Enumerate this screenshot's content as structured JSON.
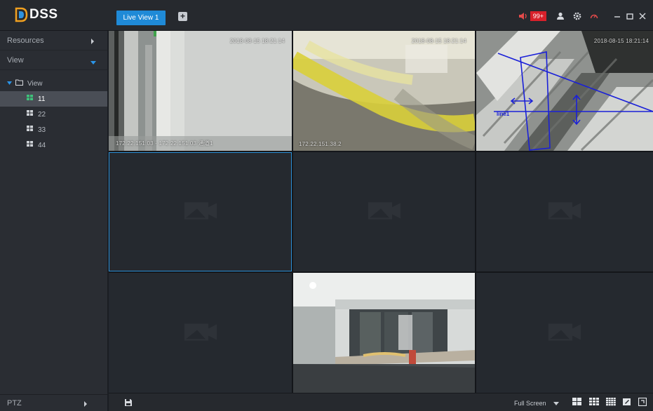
{
  "app": {
    "name": "DSS"
  },
  "tabs": [
    {
      "label": "Live View 1",
      "active": true
    }
  ],
  "add_tab_label": "+",
  "titlebar": {
    "alarm_count": "99+",
    "alarm_color": "#d8202a",
    "accent": "#1f8ad7",
    "icons": [
      "volume-icon",
      "user-icon",
      "settings-icon",
      "performance-icon",
      "minimize-icon",
      "maximize-icon",
      "close-icon"
    ]
  },
  "sidebar": {
    "resources_label": "Resources",
    "view_label": "View",
    "tree": {
      "root_label": "View",
      "items": [
        {
          "label": "11",
          "selected": true
        },
        {
          "label": "22",
          "selected": false
        },
        {
          "label": "33",
          "selected": false
        },
        {
          "label": "44",
          "selected": false
        }
      ]
    },
    "ptz_label": "PTZ"
  },
  "grid": {
    "cells": [
      {
        "has_video": true,
        "top_text": "2018-08-15 18:21:14",
        "bottom_text": "172.22.151.03 - 172.22.151.03 通道1"
      },
      {
        "has_video": true,
        "top_text": "2018-08-15 18:21:14",
        "bottom_text": "172.22.151.38.2"
      },
      {
        "has_video": true,
        "top_text": "2018-08-15 18:21:14",
        "bottom_text": "",
        "rule_label": "line1"
      },
      {
        "has_video": false
      },
      {
        "has_video": false
      },
      {
        "has_video": false
      },
      {
        "has_video": false
      },
      {
        "has_video": true,
        "top_text": "",
        "bottom_text": ""
      },
      {
        "has_video": false
      }
    ],
    "active_cell": 4
  },
  "bottombar": {
    "fullscreen_label": "Full Screen"
  }
}
